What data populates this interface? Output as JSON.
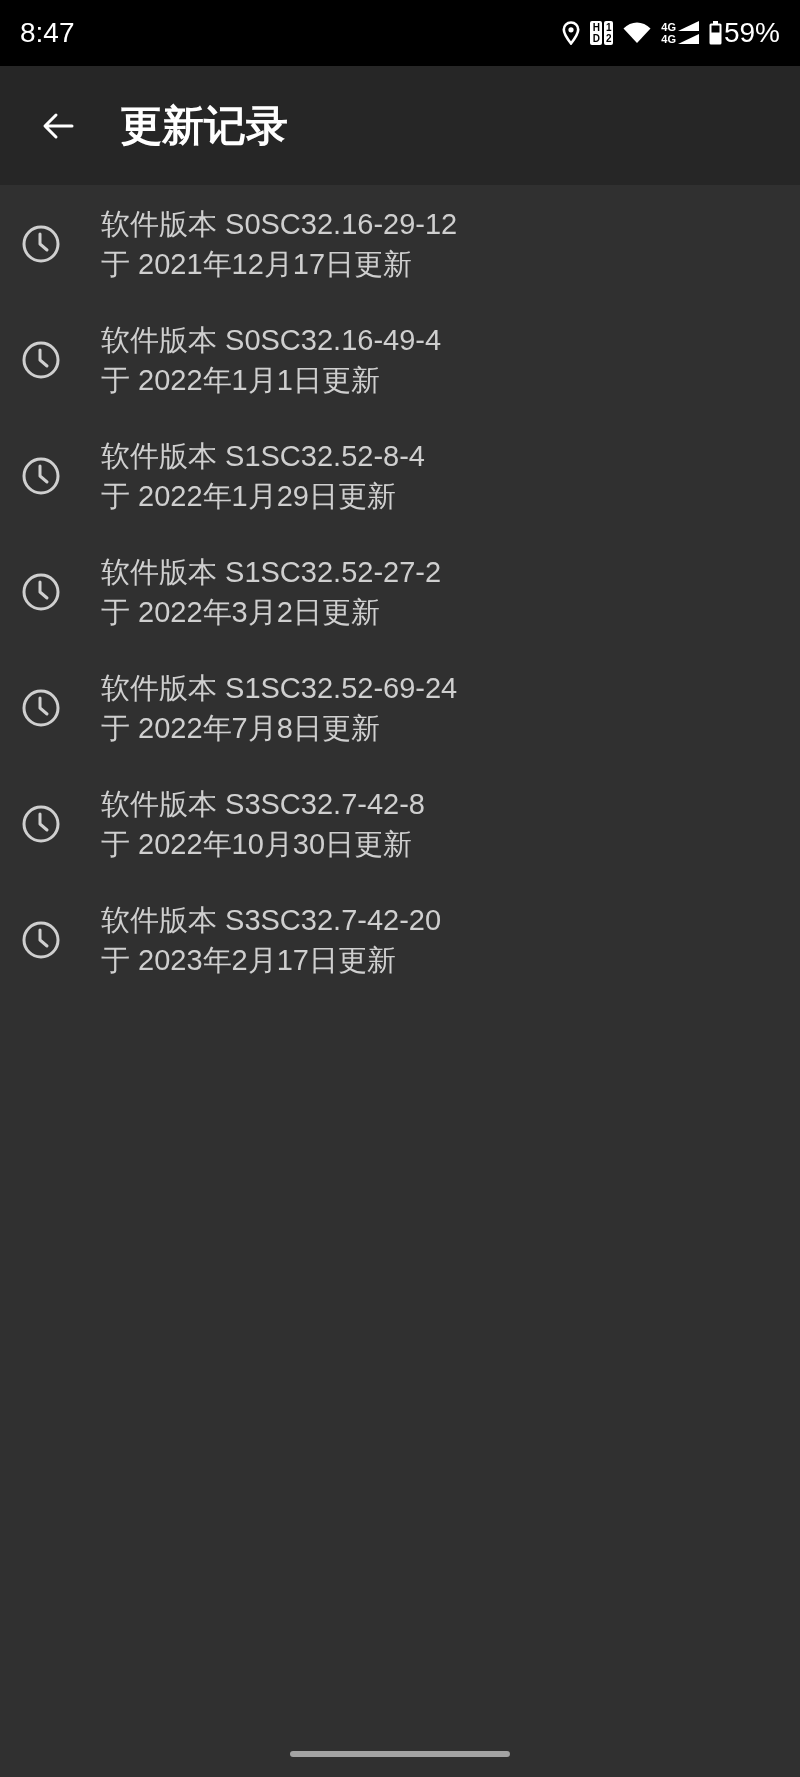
{
  "status_bar": {
    "time": "8:47",
    "hd_label": "HD",
    "sim_slots": [
      "1",
      "2"
    ],
    "network_labels": [
      "4G",
      "4G"
    ],
    "battery": "59%"
  },
  "app_bar": {
    "title": "更新记录"
  },
  "updates": [
    {
      "version": "软件版本 S0SC32.16-29-12",
      "date": "于 2021年12月17日更新"
    },
    {
      "version": "软件版本 S0SC32.16-49-4",
      "date": "于 2022年1月1日更新"
    },
    {
      "version": "软件版本 S1SC32.52-8-4",
      "date": "于 2022年1月29日更新"
    },
    {
      "version": "软件版本 S1SC32.52-27-2",
      "date": "于 2022年3月2日更新"
    },
    {
      "version": "软件版本 S1SC32.52-69-24",
      "date": "于 2022年7月8日更新"
    },
    {
      "version": "软件版本 S3SC32.7-42-8",
      "date": "于 2022年10月30日更新"
    },
    {
      "version": "软件版本 S3SC32.7-42-20",
      "date": "于 2023年2月17日更新"
    }
  ]
}
